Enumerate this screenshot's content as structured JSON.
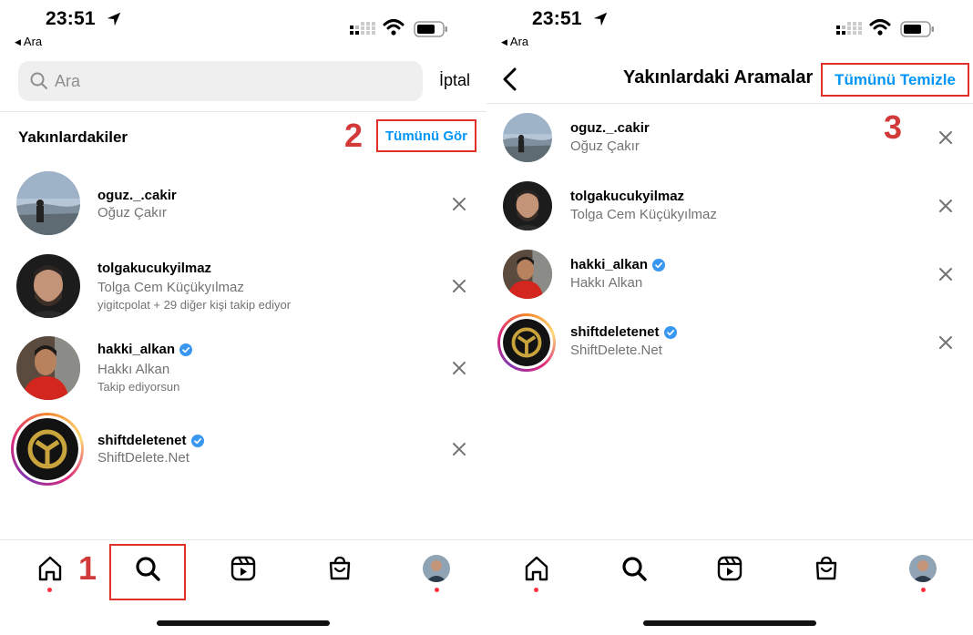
{
  "left": {
    "status": {
      "time": "23:51",
      "back_label": "Ara"
    },
    "search": {
      "placeholder": "Ara"
    },
    "cancel_label": "İptal",
    "section_title": "Yakınlardakiler",
    "see_all_label": "Tümünü Gör",
    "annotations": {
      "n1": "1",
      "n2": "2"
    },
    "items": [
      {
        "username": "oguz._.cakir",
        "fullname": "Oğuz Çakır",
        "meta": "",
        "verified": false
      },
      {
        "username": "tolgakucukyilmaz",
        "fullname": "Tolga Cem Küçükyılmaz",
        "meta": "yigitcpolat + 29 diğer kişi takip ediyor",
        "verified": false
      },
      {
        "username": "hakki_alkan",
        "fullname": "Hakkı Alkan",
        "meta": "Takip ediyorsun",
        "verified": true
      },
      {
        "username": "shiftdeletenet",
        "fullname": "ShiftDelete.Net",
        "meta": "",
        "verified": true
      }
    ]
  },
  "right": {
    "status": {
      "time": "23:51",
      "back_label": "Ara"
    },
    "page_title": "Yakınlardaki Aramalar",
    "clear_all_label": "Tümünü Temizle",
    "annotations": {
      "n3": "3"
    },
    "items": [
      {
        "username": "oguz._.cakir",
        "fullname": "Oğuz Çakır",
        "verified": false
      },
      {
        "username": "tolgakucukyilmaz",
        "fullname": "Tolga Cem Küçükyılmaz",
        "verified": false
      },
      {
        "username": "hakki_alkan",
        "fullname": "Hakkı Alkan",
        "verified": true
      },
      {
        "username": "shiftdeletenet",
        "fullname": "ShiftDelete.Net",
        "verified": true
      }
    ]
  },
  "nav": {
    "tabs": [
      "home-icon",
      "search-icon",
      "reels-icon",
      "shop-icon",
      "profile-avatar"
    ]
  },
  "colors": {
    "link_blue": "#0095f6",
    "annotation_red": "#d23a3a",
    "highlight_border": "#e0302a",
    "notification_dot": "#ff3040",
    "secondary_text": "#737373",
    "search_bg": "#efefef",
    "verified_blue": "#3897f0"
  }
}
